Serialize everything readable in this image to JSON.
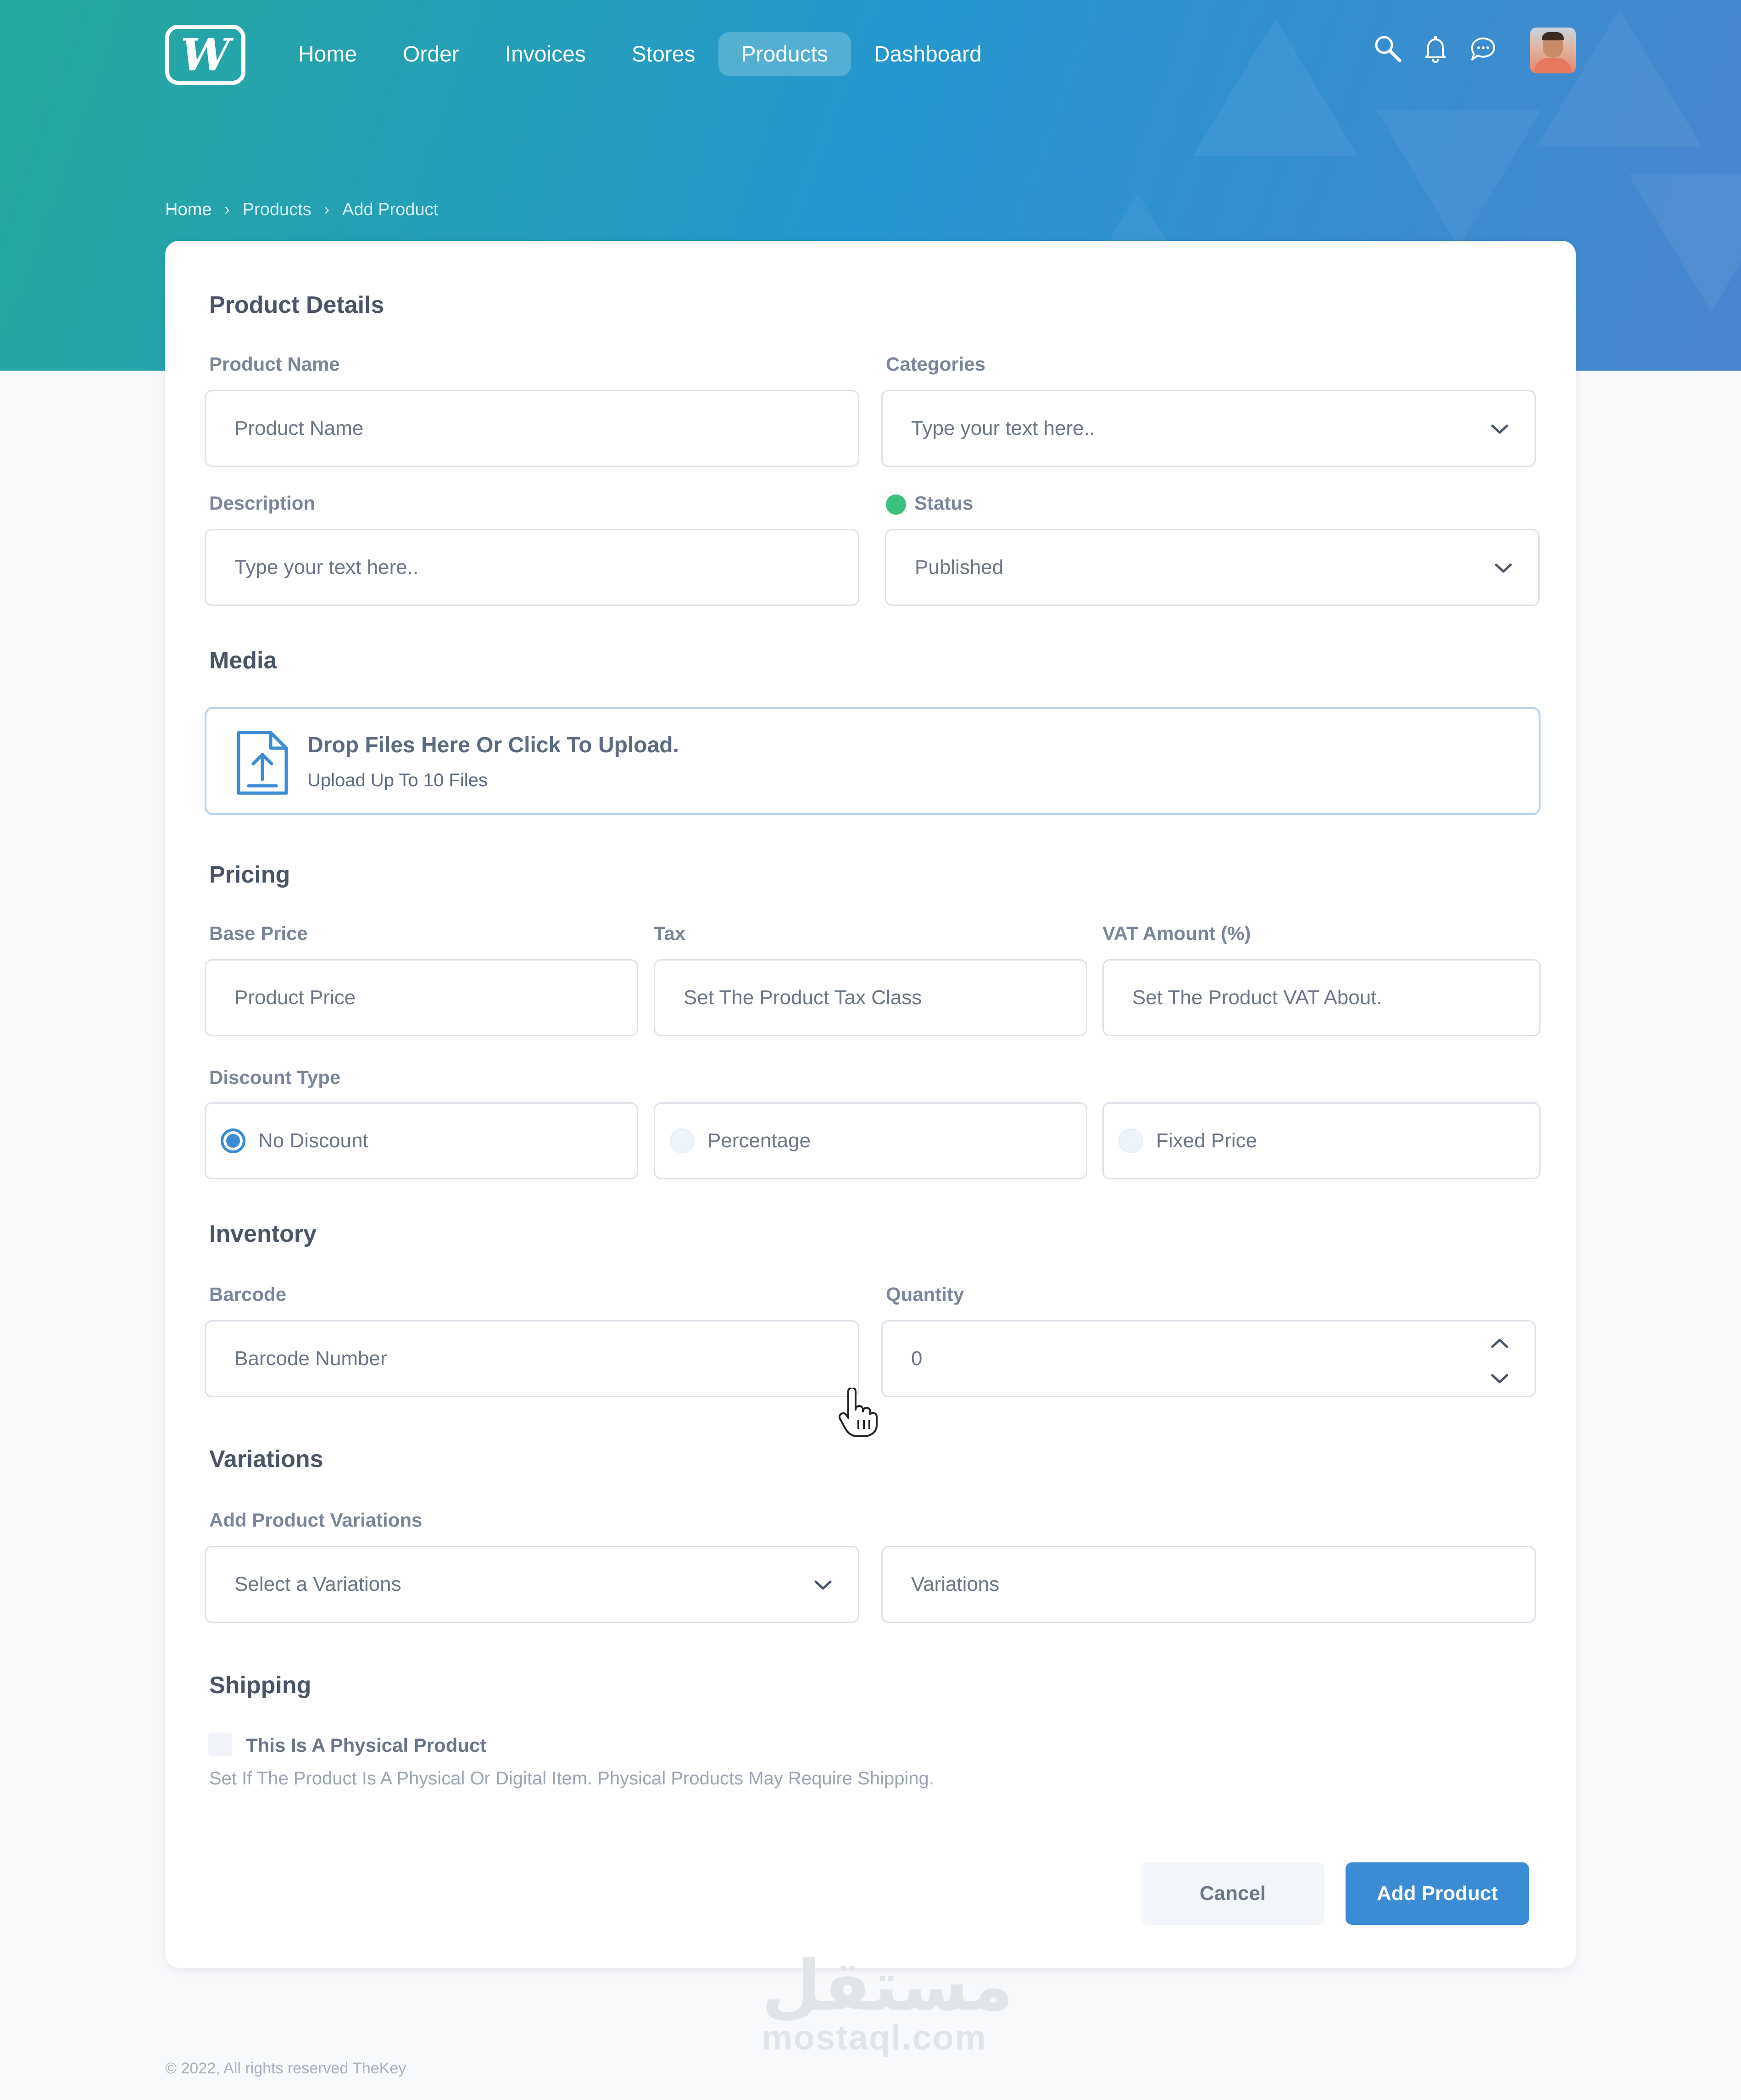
{
  "colors": {
    "accent": "#3b8cd4",
    "hero_gradient_start": "#25a99c",
    "hero_gradient_end": "#4a86cf",
    "status_green": "#3cc07c"
  },
  "header": {
    "logo_text": "W",
    "nav": [
      {
        "label": "Home",
        "active": false
      },
      {
        "label": "Order",
        "active": false
      },
      {
        "label": "Invoices",
        "active": false
      },
      {
        "label": "Stores",
        "active": false
      },
      {
        "label": "Products",
        "active": true
      },
      {
        "label": "Dashboard",
        "active": false
      }
    ],
    "icons": [
      "search-icon",
      "bell-icon",
      "chat-icon"
    ]
  },
  "breadcrumb": [
    "Home",
    "Products",
    "Add Product"
  ],
  "product_details": {
    "title": "Product Details",
    "name_label": "Product Name",
    "name_placeholder": "Product Name",
    "categories_label": "Categories",
    "categories_placeholder": "Type your text here..",
    "description_label": "Description",
    "description_placeholder": "Type your text here..",
    "status_label": "Status",
    "status_value": "Published"
  },
  "media": {
    "title": "Media",
    "upload_title": "Drop Files Here Or Click To Upload.",
    "upload_sub": "Upload Up To 10 Files"
  },
  "pricing": {
    "title": "Pricing",
    "base_price_label": "Base Price",
    "base_price_placeholder": "Product Price",
    "tax_label": "Tax",
    "tax_placeholder": "Set The Product Tax Class",
    "vat_label": "VAT Amount (%)",
    "vat_placeholder": "Set The Product VAT About.",
    "discount_label": "Discount Type",
    "discount_options": [
      {
        "label": "No Discount",
        "selected": true
      },
      {
        "label": "Percentage",
        "selected": false
      },
      {
        "label": "Fixed Price",
        "selected": false
      }
    ]
  },
  "inventory": {
    "title": "Inventory",
    "barcode_label": "Barcode",
    "barcode_placeholder": "Barcode Number",
    "quantity_label": "Quantity",
    "quantity_value": "0"
  },
  "variations": {
    "title": "Variations",
    "label": "Add Product Variations",
    "select_placeholder": "Select a Variations",
    "input_placeholder": "Variations"
  },
  "shipping": {
    "title": "Shipping",
    "physical_label": "This Is A Physical Product",
    "physical_desc": "Set If The Product Is A Physical Or Digital Item. Physical Products May Require Shipping."
  },
  "actions": {
    "cancel": "Cancel",
    "add": "Add Product"
  },
  "watermark": {
    "arabic": "مستقل",
    "latin": "mostaql.com"
  },
  "footer": "© 2022, All rights reserved TheKey"
}
